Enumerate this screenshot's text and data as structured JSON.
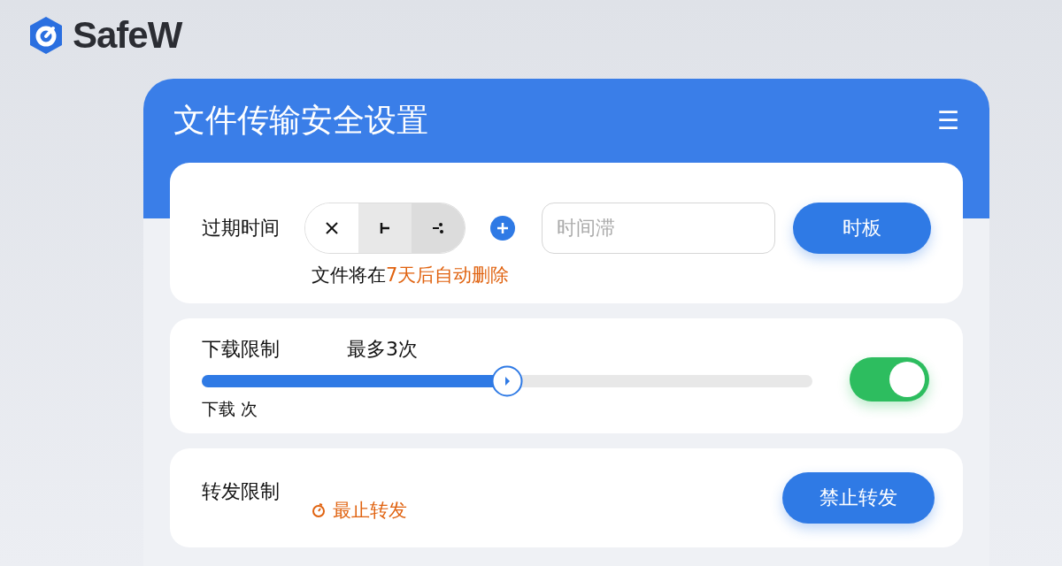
{
  "brand": {
    "name": "SafeW"
  },
  "window": {
    "title": "文件传输安全设置",
    "menu_icon": "☰"
  },
  "expiry": {
    "label": "过期时间",
    "segments": [
      {
        "kind": "cross",
        "selected": true
      },
      {
        "kind": "tee",
        "selected": false
      },
      {
        "kind": "split",
        "selected": false
      }
    ],
    "field": {
      "placeholder": "时间滞"
    },
    "button": "时板",
    "note": {
      "text": "文件将在",
      "highlight": "7天后自动删除"
    }
  },
  "download": {
    "label": "下载限制",
    "reading": "最多3次",
    "level": 0.5,
    "caption": "下载 次",
    "on": true
  },
  "forward": {
    "label": "转发限制",
    "status": "最止转发",
    "button": "禁止转发"
  }
}
